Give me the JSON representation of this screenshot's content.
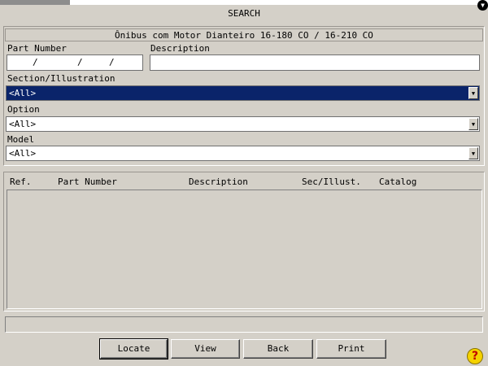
{
  "window": {
    "title": "SEARCH"
  },
  "catalog": {
    "header": "Ônibus com Motor Dianteiro 16-180 CO / 16-210 CO"
  },
  "form": {
    "part_number_label": "Part Number",
    "part_number_value": "  /    /   ",
    "description_label": "Description",
    "description_value": "",
    "section_label": "Section/Illustration",
    "section_value": "<All>",
    "option_label": "Option",
    "option_value": "<All>",
    "model_label": "Model",
    "model_value": "<All>"
  },
  "results": {
    "columns": [
      "Ref.",
      "Part Number",
      "Description",
      "Sec/Illust.",
      "Catalog"
    ],
    "rows": []
  },
  "status": {
    "text": ""
  },
  "buttons": {
    "locate": "Locate",
    "view": "View",
    "back": "Back",
    "print": "Print"
  },
  "icons": {
    "help": "?",
    "dropdown": "▼",
    "corner": "▼"
  },
  "colors": {
    "background": "#d4d0c8",
    "selection": "#0a246a",
    "help_icon": "#f5d200"
  }
}
